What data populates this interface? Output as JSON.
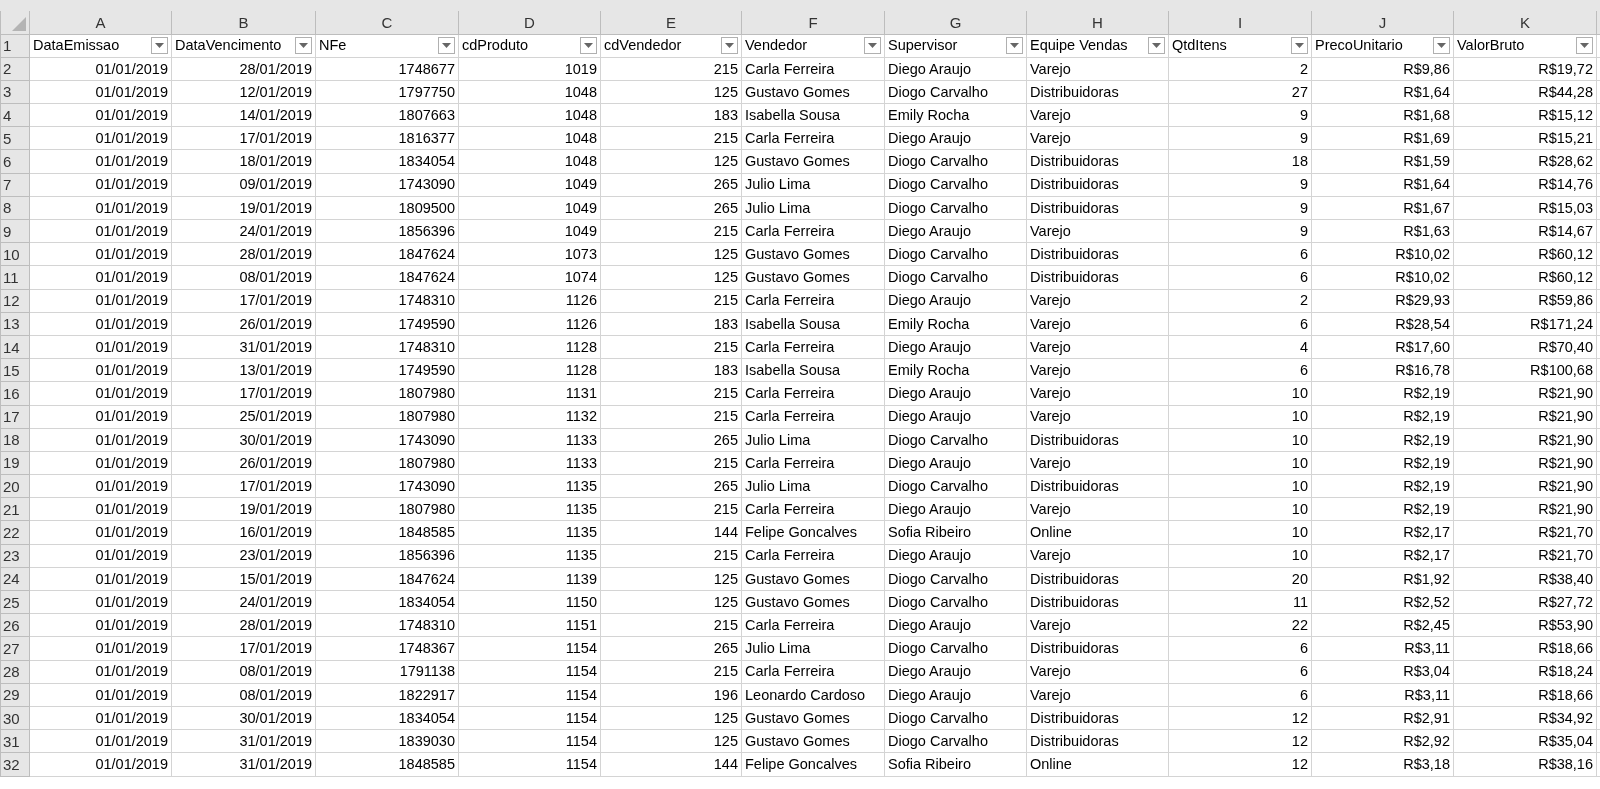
{
  "columns": [
    {
      "letter": "A",
      "header": "DataEmissao",
      "kind": "number"
    },
    {
      "letter": "B",
      "header": "DataVencimento",
      "kind": "number"
    },
    {
      "letter": "C",
      "header": "NFe",
      "kind": "number"
    },
    {
      "letter": "D",
      "header": "cdProduto",
      "kind": "number"
    },
    {
      "letter": "E",
      "header": "cdVendedor",
      "kind": "number"
    },
    {
      "letter": "F",
      "header": "Vendedor",
      "kind": "text"
    },
    {
      "letter": "G",
      "header": "Supervisor",
      "kind": "text"
    },
    {
      "letter": "H",
      "header": "Equipe Vendas",
      "kind": "text"
    },
    {
      "letter": "I",
      "header": "QtdItens",
      "kind": "number"
    },
    {
      "letter": "J",
      "header": "PrecoUnitario",
      "kind": "number"
    },
    {
      "letter": "K",
      "header": "ValorBruto",
      "kind": "number"
    }
  ],
  "header_row_number": "1",
  "rows": [
    {
      "number": "2",
      "cells": [
        "01/01/2019",
        "28/01/2019",
        "1748677",
        "1019",
        "215",
        "Carla Ferreira",
        "Diego Araujo",
        "Varejo",
        "2",
        "R$9,86",
        "R$19,72"
      ]
    },
    {
      "number": "3",
      "cells": [
        "01/01/2019",
        "12/01/2019",
        "1797750",
        "1048",
        "125",
        "Gustavo Gomes",
        "Diogo Carvalho",
        "Distribuidoras",
        "27",
        "R$1,64",
        "R$44,28"
      ]
    },
    {
      "number": "4",
      "cells": [
        "01/01/2019",
        "14/01/2019",
        "1807663",
        "1048",
        "183",
        "Isabella Sousa",
        "Emily Rocha",
        "Varejo",
        "9",
        "R$1,68",
        "R$15,12"
      ]
    },
    {
      "number": "5",
      "cells": [
        "01/01/2019",
        "17/01/2019",
        "1816377",
        "1048",
        "215",
        "Carla Ferreira",
        "Diego Araujo",
        "Varejo",
        "9",
        "R$1,69",
        "R$15,21"
      ]
    },
    {
      "number": "6",
      "cells": [
        "01/01/2019",
        "18/01/2019",
        "1834054",
        "1048",
        "125",
        "Gustavo Gomes",
        "Diogo Carvalho",
        "Distribuidoras",
        "18",
        "R$1,59",
        "R$28,62"
      ]
    },
    {
      "number": "7",
      "cells": [
        "01/01/2019",
        "09/01/2019",
        "1743090",
        "1049",
        "265",
        "Julio Lima",
        "Diogo Carvalho",
        "Distribuidoras",
        "9",
        "R$1,64",
        "R$14,76"
      ]
    },
    {
      "number": "8",
      "cells": [
        "01/01/2019",
        "19/01/2019",
        "1809500",
        "1049",
        "265",
        "Julio Lima",
        "Diogo Carvalho",
        "Distribuidoras",
        "9",
        "R$1,67",
        "R$15,03"
      ]
    },
    {
      "number": "9",
      "cells": [
        "01/01/2019",
        "24/01/2019",
        "1856396",
        "1049",
        "215",
        "Carla Ferreira",
        "Diego Araujo",
        "Varejo",
        "9",
        "R$1,63",
        "R$14,67"
      ]
    },
    {
      "number": "10",
      "cells": [
        "01/01/2019",
        "28/01/2019",
        "1847624",
        "1073",
        "125",
        "Gustavo Gomes",
        "Diogo Carvalho",
        "Distribuidoras",
        "6",
        "R$10,02",
        "R$60,12"
      ]
    },
    {
      "number": "11",
      "cells": [
        "01/01/2019",
        "08/01/2019",
        "1847624",
        "1074",
        "125",
        "Gustavo Gomes",
        "Diogo Carvalho",
        "Distribuidoras",
        "6",
        "R$10,02",
        "R$60,12"
      ]
    },
    {
      "number": "12",
      "cells": [
        "01/01/2019",
        "17/01/2019",
        "1748310",
        "1126",
        "215",
        "Carla Ferreira",
        "Diego Araujo",
        "Varejo",
        "2",
        "R$29,93",
        "R$59,86"
      ]
    },
    {
      "number": "13",
      "cells": [
        "01/01/2019",
        "26/01/2019",
        "1749590",
        "1126",
        "183",
        "Isabella Sousa",
        "Emily Rocha",
        "Varejo",
        "6",
        "R$28,54",
        "R$171,24"
      ]
    },
    {
      "number": "14",
      "cells": [
        "01/01/2019",
        "31/01/2019",
        "1748310",
        "1128",
        "215",
        "Carla Ferreira",
        "Diego Araujo",
        "Varejo",
        "4",
        "R$17,60",
        "R$70,40"
      ]
    },
    {
      "number": "15",
      "cells": [
        "01/01/2019",
        "13/01/2019",
        "1749590",
        "1128",
        "183",
        "Isabella Sousa",
        "Emily Rocha",
        "Varejo",
        "6",
        "R$16,78",
        "R$100,68"
      ]
    },
    {
      "number": "16",
      "cells": [
        "01/01/2019",
        "17/01/2019",
        "1807980",
        "1131",
        "215",
        "Carla Ferreira",
        "Diego Araujo",
        "Varejo",
        "10",
        "R$2,19",
        "R$21,90"
      ]
    },
    {
      "number": "17",
      "cells": [
        "01/01/2019",
        "25/01/2019",
        "1807980",
        "1132",
        "215",
        "Carla Ferreira",
        "Diego Araujo",
        "Varejo",
        "10",
        "R$2,19",
        "R$21,90"
      ]
    },
    {
      "number": "18",
      "cells": [
        "01/01/2019",
        "30/01/2019",
        "1743090",
        "1133",
        "265",
        "Julio Lima",
        "Diogo Carvalho",
        "Distribuidoras",
        "10",
        "R$2,19",
        "R$21,90"
      ]
    },
    {
      "number": "19",
      "cells": [
        "01/01/2019",
        "26/01/2019",
        "1807980",
        "1133",
        "215",
        "Carla Ferreira",
        "Diego Araujo",
        "Varejo",
        "10",
        "R$2,19",
        "R$21,90"
      ]
    },
    {
      "number": "20",
      "cells": [
        "01/01/2019",
        "17/01/2019",
        "1743090",
        "1135",
        "265",
        "Julio Lima",
        "Diogo Carvalho",
        "Distribuidoras",
        "10",
        "R$2,19",
        "R$21,90"
      ]
    },
    {
      "number": "21",
      "cells": [
        "01/01/2019",
        "19/01/2019",
        "1807980",
        "1135",
        "215",
        "Carla Ferreira",
        "Diego Araujo",
        "Varejo",
        "10",
        "R$2,19",
        "R$21,90"
      ]
    },
    {
      "number": "22",
      "cells": [
        "01/01/2019",
        "16/01/2019",
        "1848585",
        "1135",
        "144",
        "Felipe Goncalves",
        "Sofia Ribeiro",
        "Online",
        "10",
        "R$2,17",
        "R$21,70"
      ]
    },
    {
      "number": "23",
      "cells": [
        "01/01/2019",
        "23/01/2019",
        "1856396",
        "1135",
        "215",
        "Carla Ferreira",
        "Diego Araujo",
        "Varejo",
        "10",
        "R$2,17",
        "R$21,70"
      ]
    },
    {
      "number": "24",
      "cells": [
        "01/01/2019",
        "15/01/2019",
        "1847624",
        "1139",
        "125",
        "Gustavo Gomes",
        "Diogo Carvalho",
        "Distribuidoras",
        "20",
        "R$1,92",
        "R$38,40"
      ]
    },
    {
      "number": "25",
      "cells": [
        "01/01/2019",
        "24/01/2019",
        "1834054",
        "1150",
        "125",
        "Gustavo Gomes",
        "Diogo Carvalho",
        "Distribuidoras",
        "11",
        "R$2,52",
        "R$27,72"
      ]
    },
    {
      "number": "26",
      "cells": [
        "01/01/2019",
        "28/01/2019",
        "1748310",
        "1151",
        "215",
        "Carla Ferreira",
        "Diego Araujo",
        "Varejo",
        "22",
        "R$2,45",
        "R$53,90"
      ]
    },
    {
      "number": "27",
      "cells": [
        "01/01/2019",
        "17/01/2019",
        "1748367",
        "1154",
        "265",
        "Julio Lima",
        "Diogo Carvalho",
        "Distribuidoras",
        "6",
        "R$3,11",
        "R$18,66"
      ]
    },
    {
      "number": "28",
      "cells": [
        "01/01/2019",
        "08/01/2019",
        "1791138",
        "1154",
        "215",
        "Carla Ferreira",
        "Diego Araujo",
        "Varejo",
        "6",
        "R$3,04",
        "R$18,24"
      ]
    },
    {
      "number": "29",
      "cells": [
        "01/01/2019",
        "08/01/2019",
        "1822917",
        "1154",
        "196",
        "Leonardo Cardoso",
        "Diego Araujo",
        "Varejo",
        "6",
        "R$3,11",
        "R$18,66"
      ]
    },
    {
      "number": "30",
      "cells": [
        "01/01/2019",
        "30/01/2019",
        "1834054",
        "1154",
        "125",
        "Gustavo Gomes",
        "Diogo Carvalho",
        "Distribuidoras",
        "12",
        "R$2,91",
        "R$34,92"
      ]
    },
    {
      "number": "31",
      "cells": [
        "01/01/2019",
        "31/01/2019",
        "1839030",
        "1154",
        "125",
        "Gustavo Gomes",
        "Diogo Carvalho",
        "Distribuidoras",
        "12",
        "R$2,92",
        "R$35,04"
      ]
    },
    {
      "number": "32",
      "cells": [
        "01/01/2019",
        "31/01/2019",
        "1848585",
        "1154",
        "144",
        "Felipe Goncalves",
        "Sofia Ribeiro",
        "Online",
        "12",
        "R$3,18",
        "R$38,16"
      ]
    }
  ]
}
